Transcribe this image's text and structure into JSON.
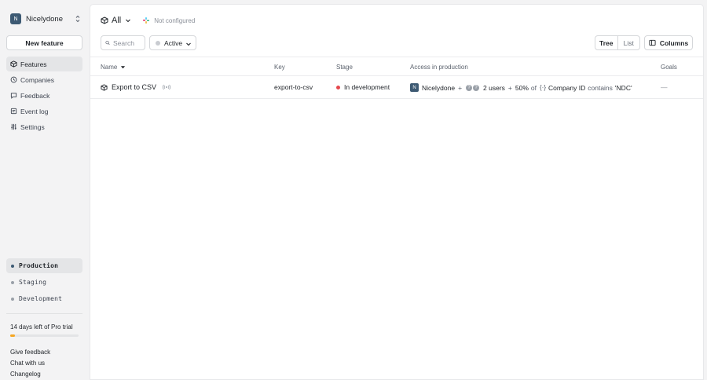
{
  "sidebar": {
    "org_initial": "N",
    "org_name": "Nicelydone",
    "new_feature_label": "New feature",
    "nav": [
      {
        "label": "Features",
        "icon": "box-icon",
        "active": true
      },
      {
        "label": "Companies",
        "icon": "building-icon",
        "active": false
      },
      {
        "label": "Feedback",
        "icon": "chat-icon",
        "active": false
      },
      {
        "label": "Event log",
        "icon": "list-icon",
        "active": false
      },
      {
        "label": "Settings",
        "icon": "sliders-icon",
        "active": false
      }
    ],
    "environments": [
      {
        "label": "Production",
        "active": true,
        "color": "#3d5a73"
      },
      {
        "label": "Staging",
        "active": false,
        "color": "#9aa0a8"
      },
      {
        "label": "Development",
        "active": false,
        "color": "#9aa0a8"
      }
    ],
    "trial_text": "14 days left of Pro trial",
    "trial_progress": 0.07,
    "trial_color": "#f5a623",
    "links": [
      "Give feedback",
      "Chat with us",
      "Changelog"
    ]
  },
  "header": {
    "scope_label": "All",
    "integration_label": "Not configured"
  },
  "toolbar": {
    "search_placeholder": "Search",
    "status_label": "Active",
    "view_tree": "Tree",
    "view_list": "List",
    "columns_label": "Columns"
  },
  "table": {
    "columns": [
      "Name",
      "Key",
      "Stage",
      "Access in production",
      "Goals"
    ],
    "rows": [
      {
        "name": "Export to CSV",
        "key": "export-to-csv",
        "stage": "In development",
        "stage_color": "#e5484d",
        "access": {
          "org_initial": "N",
          "org_name": "Nicelydone",
          "plus1": "+",
          "users_label": "2 users",
          "plus2": "+",
          "percent": "50%",
          "of": "of",
          "condition_icon": "{·}",
          "condition_field": "Company ID",
          "condition_op": "contains",
          "condition_value": "'NDC'"
        },
        "goals": "—"
      }
    ]
  }
}
